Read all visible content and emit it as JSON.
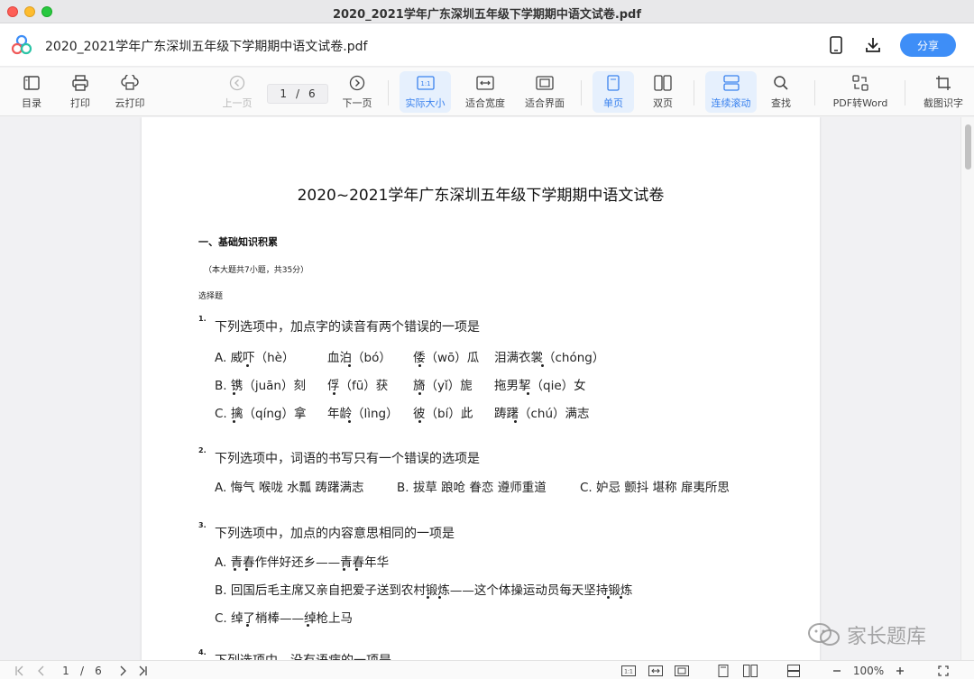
{
  "window": {
    "title": "2020_2021学年广东深圳五年级下学期期中语文试卷.pdf"
  },
  "appbar": {
    "file_name": "2020_2021学年广东深圳五年级下学期期中语文试卷.pdf",
    "share_label": "分享"
  },
  "toolbar": {
    "toc": "目录",
    "print": "打印",
    "cloud_print": "云打印",
    "prev_page": "上一页",
    "page_current": "1",
    "page_sep": "/",
    "page_total": "6",
    "next_page": "下一页",
    "actual_size": "实际大小",
    "fit_width": "适合宽度",
    "fit_page": "适合界面",
    "single_page": "单页",
    "double_page": "双页",
    "continuous_scroll": "连续滚动",
    "find": "查找",
    "pdf_to_word": "PDF转Word",
    "ocr": "截图识字"
  },
  "document": {
    "title": "2020~2021学年广东深圳五年级下学期期中语文试卷",
    "section_head": "一、基础知识积累",
    "section_note": "（本大题共7小题，共35分）",
    "section_type": "选择题",
    "questions": [
      {
        "num": "1.",
        "stem": "下列选项中，加点字的读音有两个错误的一项是",
        "rows": [
          [
            "A. 威吓（hè）",
            "血泊（bó）",
            "倭（wō）瓜",
            "泪满衣裳（chóng）"
          ],
          [
            "B. 镌（juān）刻",
            "俘（fū）获",
            "旖（yǐ）旎",
            "拖男挈（qie）女"
          ],
          [
            "C. 擒（qíng）拿",
            "年龄（lìng）",
            "彼（bí）此",
            "踌躇（chú）满志"
          ]
        ]
      },
      {
        "num": "2.",
        "stem": "下列选项中，词语的书写只有一个错误的选项是",
        "rows": [
          [
            "A. 悔气 喉咙 水瓢 踌躇满志",
            "B. 拔草 踉呛 眷恋 遵师重道",
            "C. 妒忌 颤抖 堪称 扉夷所思"
          ]
        ]
      },
      {
        "num": "3.",
        "stem": "下列选项中，加点的内容意思相同的一项是",
        "rows": [
          [
            "A. 青春作伴好还乡——青春年华"
          ],
          [
            "B. 回国后毛主席又亲自把爱子送到农村锻炼——这个体操运动员每天坚持锻炼"
          ],
          [
            "C. 绰了梢棒——绰枪上马"
          ]
        ]
      },
      {
        "num": "4.",
        "stem": "下列选项中，没有语病的一项是"
      }
    ]
  },
  "statusbar": {
    "page_current": "1",
    "page_sep": "/",
    "page_total": "6",
    "zoom": "100%"
  },
  "watermark": {
    "text": "家长题库"
  }
}
